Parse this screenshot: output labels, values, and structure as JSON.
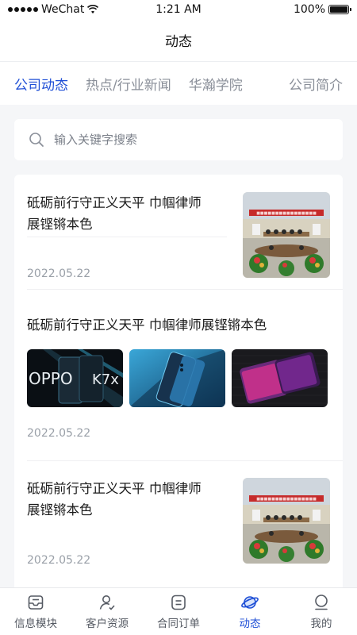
{
  "status": {
    "carrier": "WeChat",
    "time": "1:21 AM",
    "battery": "100%"
  },
  "nav": {
    "title": "动态"
  },
  "tabs": [
    "公司动态",
    "热点/行业新闻",
    "华瀚学院",
    "公司简介"
  ],
  "active_tab": "公司动态",
  "search": {
    "placeholder": "输入关键字搜索"
  },
  "articles": [
    {
      "title_line1": "砥砺前行守正义天平 巾帼律师",
      "title_line2": "展铿锵本色",
      "date": "2022.05.22",
      "thumb": "meeting-photo"
    },
    {
      "title": "砥砺前行守正义天平 巾帼律师展铿锵本色",
      "date": "2022.05.22",
      "thumbs": [
        "oppo-k7x-phone-photo",
        "blue-phone-photo",
        "purple-phone-photo"
      ]
    },
    {
      "title_line1": "砥砺前行守正义天平 巾帼律师",
      "title_line2": "展铿锵本色",
      "date": "2022.05.22",
      "thumb": "meeting-photo"
    }
  ],
  "thumb_text": {
    "oppo_brand": "OPPO",
    "oppo_model": "K7x",
    "banner": "■■■■■■■■■■■■■■■■"
  },
  "tab_bar": [
    {
      "label": "信息模块",
      "icon": "inbox-icon"
    },
    {
      "label": "客户资源",
      "icon": "user-check-icon"
    },
    {
      "label": "合同订单",
      "icon": "document-icon"
    },
    {
      "label": "动态",
      "icon": "planet-icon"
    },
    {
      "label": "我的",
      "icon": "profile-icon"
    }
  ],
  "colors": {
    "accent": "#1f4fd6",
    "background": "#f5f6f8",
    "muted": "#9aa0a8"
  }
}
